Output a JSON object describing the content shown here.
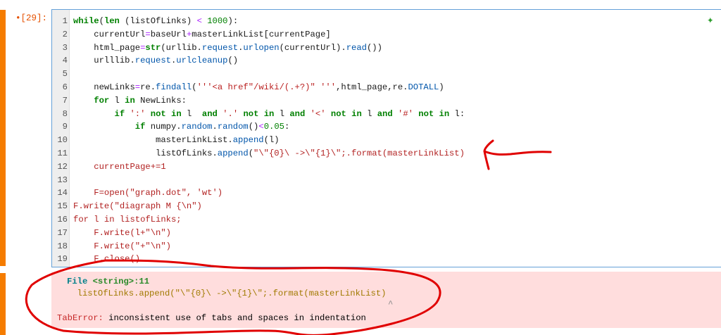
{
  "cell": {
    "prompt": "•[29]:",
    "sparkle_icon": "sparkle-icon",
    "code_lines": [
      [
        [
          "while",
          "k"
        ],
        [
          "(",
          ""
        ],
        [
          "len",
          "k"
        ],
        [
          " (listOfLinks) ",
          ""
        ],
        [
          "<",
          "o"
        ],
        [
          " ",
          ""
        ],
        [
          "1000",
          "n"
        ],
        [
          "):",
          ""
        ]
      ],
      [
        [
          "    currentUrl",
          ""
        ],
        [
          "=",
          "o"
        ],
        [
          "baseUrl",
          ""
        ],
        [
          "+",
          "o"
        ],
        [
          "masterLinkList[currentPage]",
          ""
        ]
      ],
      [
        [
          "    html_page",
          ""
        ],
        [
          "=",
          "o"
        ],
        [
          "str",
          "k"
        ],
        [
          "(urllib.",
          ""
        ],
        [
          "request",
          "a"
        ],
        [
          ".",
          ""
        ],
        [
          "urlopen",
          "a"
        ],
        [
          "(currentUrl).",
          ""
        ],
        [
          "read",
          "a"
        ],
        [
          "())",
          ""
        ]
      ],
      [
        [
          "    urlllib.",
          ""
        ],
        [
          "request",
          "a"
        ],
        [
          ".",
          ""
        ],
        [
          "urlcleanup",
          "a"
        ],
        [
          "()",
          ""
        ]
      ],
      [],
      [
        [
          "    newLinks",
          ""
        ],
        [
          "=",
          "o"
        ],
        [
          "re.",
          ""
        ],
        [
          "findall",
          "a"
        ],
        [
          "(",
          ""
        ],
        [
          "'''<a href\"/wiki/(.+?)\" '''",
          "s"
        ],
        [
          ",html_page,re.",
          ""
        ],
        [
          "DOTALL",
          "a"
        ],
        [
          ")",
          ""
        ]
      ],
      [
        [
          "    ",
          ""
        ],
        [
          "for",
          "k"
        ],
        [
          " l ",
          ""
        ],
        [
          "in",
          "k"
        ],
        [
          " NewLinks:",
          ""
        ]
      ],
      [
        [
          "        ",
          ""
        ],
        [
          "if",
          "k"
        ],
        [
          " ",
          ""
        ],
        [
          "':'",
          "s"
        ],
        [
          " ",
          ""
        ],
        [
          "not in",
          "k"
        ],
        [
          " l  ",
          ""
        ],
        [
          "and",
          "k"
        ],
        [
          " ",
          ""
        ],
        [
          "'.'",
          "s"
        ],
        [
          " ",
          ""
        ],
        [
          "not in",
          "k"
        ],
        [
          " l ",
          ""
        ],
        [
          "and",
          "k"
        ],
        [
          " ",
          ""
        ],
        [
          "'<'",
          "s"
        ],
        [
          " ",
          ""
        ],
        [
          "not in",
          "k"
        ],
        [
          " l ",
          ""
        ],
        [
          "and",
          "k"
        ],
        [
          " ",
          ""
        ],
        [
          "'#'",
          "s"
        ],
        [
          " ",
          ""
        ],
        [
          "not in",
          "k"
        ],
        [
          " l:",
          ""
        ]
      ],
      [
        [
          "            ",
          ""
        ],
        [
          "if",
          "k"
        ],
        [
          " numpy.",
          ""
        ],
        [
          "random",
          "a"
        ],
        [
          ".",
          ""
        ],
        [
          "random",
          "a"
        ],
        [
          "()",
          ""
        ],
        [
          "<",
          "o"
        ],
        [
          "0.05",
          "n"
        ],
        [
          ":",
          ""
        ]
      ],
      [
        [
          "                masterLinkList.",
          ""
        ],
        [
          "append",
          "a"
        ],
        [
          "(l)",
          ""
        ]
      ],
      [
        [
          "                listOfLinks.",
          ""
        ],
        [
          "append",
          "a"
        ],
        [
          "(",
          ""
        ],
        [
          "\"\\\"{0}\\ ->\\\"{1}\\\";.format(masterLinkList)",
          "e"
        ]
      ],
      [
        [
          "    currentPage+=1",
          "e"
        ]
      ],
      [],
      [
        [
          "    F=open(\"graph.dot\", 'wt')",
          "e"
        ]
      ],
      [
        [
          "F.write(\"diagraph M {\\n\")",
          "e"
        ]
      ],
      [
        [
          "for l in listofLinks;",
          "e"
        ]
      ],
      [
        [
          "    F.write(l+\"\\n\")",
          "e"
        ]
      ],
      [
        [
          "    F.write(\"+\"\\n\")",
          "e"
        ]
      ],
      [
        [
          "    F.close()",
          "e"
        ]
      ]
    ]
  },
  "output": {
    "file_label": "File ",
    "file_loc": "<string>:11",
    "error_line": "  listOfLinks.append(\"\\\"{0}\\ ->\\\"{1}\\\";.format(masterLinkList)",
    "caret": "^",
    "error_type": "TabError:",
    "error_message": " inconsistent use of tabs and spaces in indentation"
  },
  "colors": {
    "cell_bar": "#f57c00",
    "error_bg": "#ffdddd",
    "annotation": "#e00000"
  }
}
